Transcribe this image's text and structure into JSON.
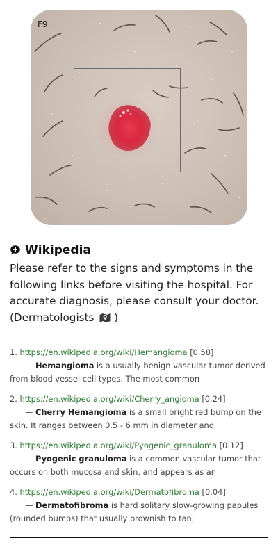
{
  "image_panel": {
    "frame_label": "F9"
  },
  "wiki": {
    "title": "Wikipedia",
    "icon": "chat-bubble-plus-icon",
    "intro_text": "Please refer to the signs and symptoms in the following links before visiting the hospital. For accurate diagnosis, please consult your doctor. (Dermatologists",
    "intro_suffix": " )",
    "map_icon": "map-marker-icon"
  },
  "results": [
    {
      "index": "1.",
      "url": "https://en.wikipedia.org/wiki/Hemangioma",
      "score": "[0.58]",
      "term": "Hemangioma",
      "description": " is a usually benign vascular tumor derived from blood vessel cell types. The most common"
    },
    {
      "index": "2.",
      "url": "https://en.wikipedia.org/wiki/Cherry_angioma",
      "score": "[0.24]",
      "term": "Cherry Hemangioma",
      "description": " is a small bright red bump on the skin. It ranges between 0.5 - 6 mm in diameter and"
    },
    {
      "index": "3.",
      "url": "https://en.wikipedia.org/wiki/Pyogenic_granuloma",
      "score": "[0.12]",
      "term": "Pyogenic granuloma",
      "description": " is a common vascular tumor that occurs on both mucosa and skin, and appears as an"
    },
    {
      "index": "4.",
      "url": "https://en.wikipedia.org/wiki/Dermatofibroma",
      "score": "[0.04]",
      "term": "Dermatofibroma",
      "description": " is hard solitary slow-growing papules (rounded bumps) that usually brownish to tan;"
    }
  ],
  "colors": {
    "link": "#2e7d32",
    "lesion": "#d9283f",
    "skin": "#cfc2b8"
  }
}
